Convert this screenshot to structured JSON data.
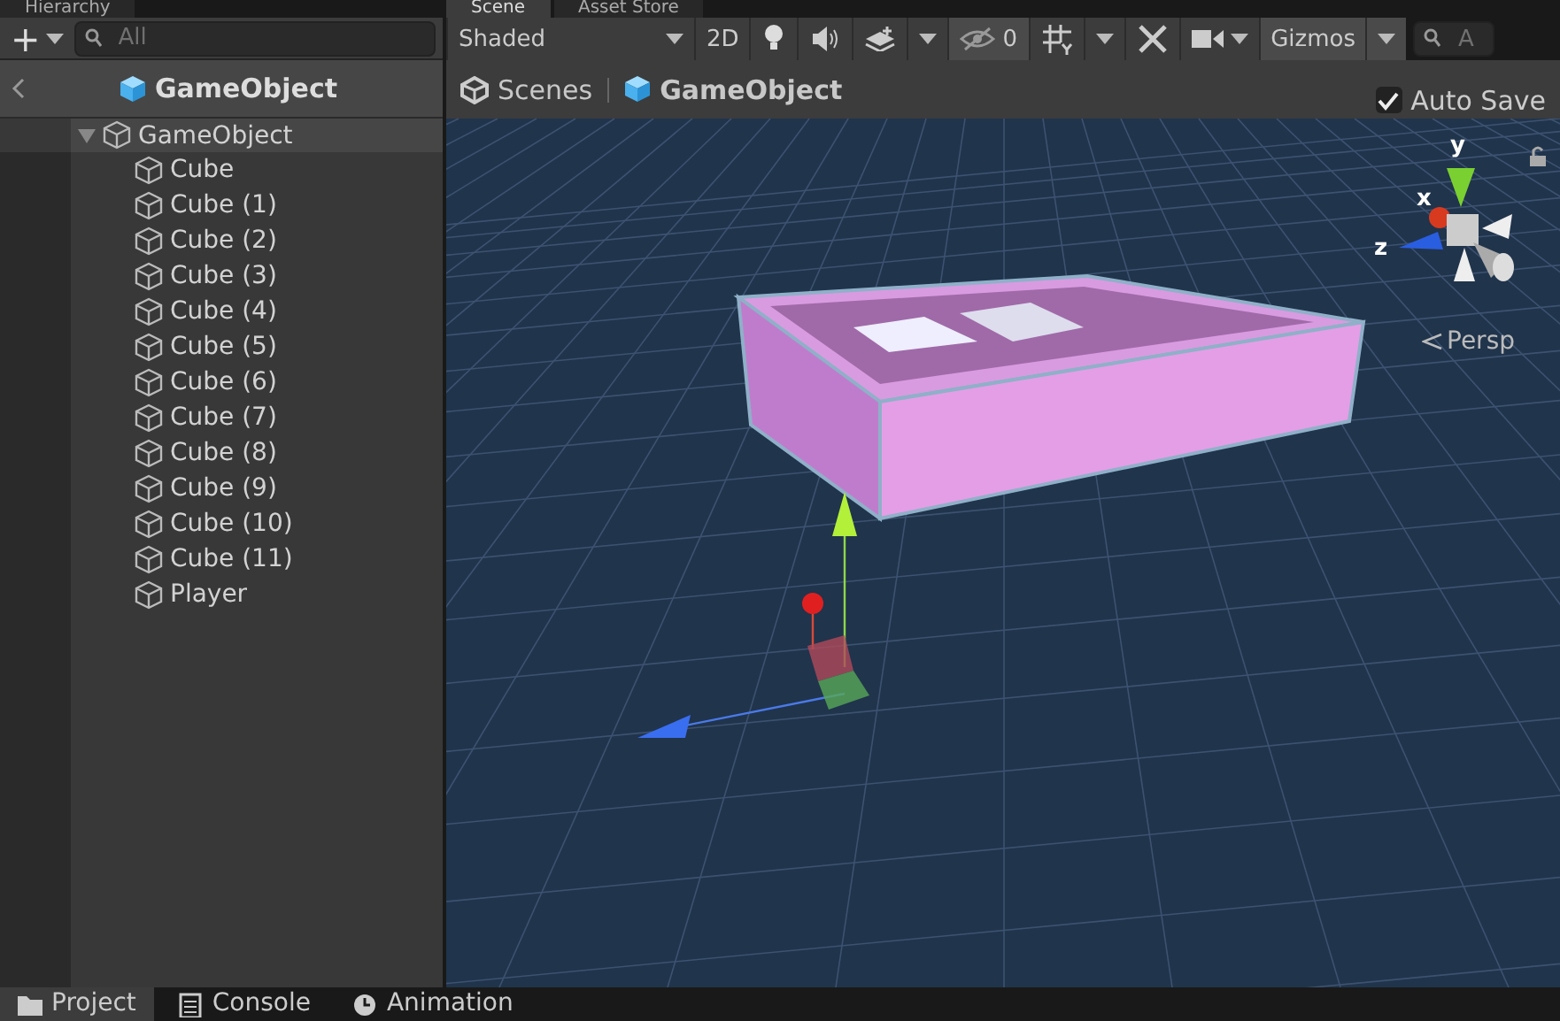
{
  "hierarchy_tabs": [
    {
      "label": "Hierarchy",
      "selected": false
    }
  ],
  "scene_tabs": [
    {
      "label": "Scene",
      "selected": true
    },
    {
      "label": "Asset Store",
      "selected": false
    }
  ],
  "hierarchy": {
    "add_symbol": "+",
    "search": {
      "placeholder": "All"
    },
    "breadcrumb": "GameObject",
    "tree": [
      {
        "label": "GameObject",
        "expanded": true,
        "children": [
          {
            "label": "Cube"
          },
          {
            "label": "Cube (1)"
          },
          {
            "label": "Cube (2)"
          },
          {
            "label": "Cube (3)"
          },
          {
            "label": "Cube (4)"
          },
          {
            "label": "Cube (5)"
          },
          {
            "label": "Cube (6)"
          },
          {
            "label": "Cube (7)"
          },
          {
            "label": "Cube (8)"
          },
          {
            "label": "Cube (9)"
          },
          {
            "label": "Cube (10)"
          },
          {
            "label": "Cube (11)"
          },
          {
            "label": "Player"
          }
        ]
      }
    ]
  },
  "scene_toolbar": {
    "shading": "Shaded",
    "mode_2d": "2D",
    "hidden_count": "0",
    "gizmos": "Gizmos",
    "search": {
      "placeholder": "A"
    }
  },
  "scene_breadcrumb": [
    {
      "label": "Scenes",
      "kind": "scenes"
    },
    {
      "label": "GameObject",
      "kind": "object"
    }
  ],
  "auto_save": {
    "label": "Auto Save",
    "checked": true
  },
  "scene_view": {
    "axes": [
      {
        "label": "y"
      },
      {
        "label": "x"
      },
      {
        "label": "z"
      }
    ],
    "projection": "Persp"
  },
  "bottom_tabs": [
    {
      "label": "Project",
      "selected": true,
      "kind": "folder"
    },
    {
      "label": "Console",
      "selected": false,
      "kind": "console"
    },
    {
      "label": "Animation",
      "selected": false,
      "kind": "clock"
    }
  ]
}
